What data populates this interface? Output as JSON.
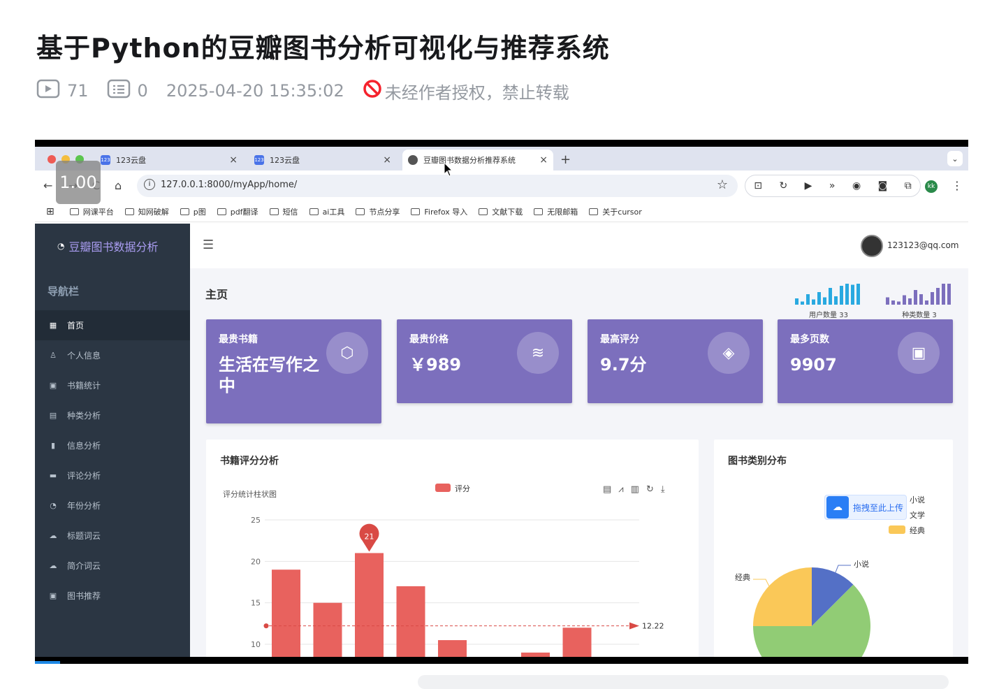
{
  "page": {
    "title": "基于Python的豆瓣图书分析可视化与推荐系统",
    "views": "71",
    "comments": "0",
    "date": "2025-04-20 15:35:02",
    "notice": "未经作者授权，禁止转载"
  },
  "player": {
    "speed": "1.00"
  },
  "browser": {
    "tabs": [
      {
        "label": "123云盘",
        "icon": "123"
      },
      {
        "label": "123云盘",
        "icon": "123"
      },
      {
        "label": "豆瓣图书数据分析推荐系统",
        "icon": "globe"
      }
    ],
    "url": "127.0.0.1:8000/myApp/home/",
    "profile": "kk",
    "bookmarks": [
      "网课平台",
      "知网破解",
      "p图",
      "pdf翻译",
      "短信",
      "ai工具",
      "节点分享",
      "Firefox 导入",
      "文献下载",
      "无限邮箱",
      "关于cursor"
    ]
  },
  "app": {
    "brand": "豆瓣图书数据分析",
    "nav_title": "导航栏",
    "menu": [
      {
        "label": "首页",
        "icon": "grid-icon",
        "glyph": "▦"
      },
      {
        "label": "个人信息",
        "icon": "person-icon",
        "glyph": "♙"
      },
      {
        "label": "书籍统计",
        "icon": "calendar-icon",
        "glyph": "▣"
      },
      {
        "label": "种类分析",
        "icon": "print-icon",
        "glyph": "▤"
      },
      {
        "label": "信息分析",
        "icon": "book-icon",
        "glyph": "▮"
      },
      {
        "label": "评论分析",
        "icon": "comment-icon",
        "glyph": "▬"
      },
      {
        "label": "年份分析",
        "icon": "history-icon",
        "glyph": "◔"
      },
      {
        "label": "标题词云",
        "icon": "cloud-icon",
        "glyph": "☁"
      },
      {
        "label": "简介词云",
        "icon": "cloud-upload-icon",
        "glyph": "☁"
      },
      {
        "label": "图书推荐",
        "icon": "plus-square-icon",
        "glyph": "▣"
      }
    ],
    "user_email": "123123@qq.com",
    "page_title": "主页",
    "mini_stats": [
      {
        "label": "用户数量 33",
        "color": "#29a9e0",
        "values": [
          0.3,
          0.15,
          0.5,
          0.25,
          0.6,
          0.35,
          0.8,
          0.4,
          0.9,
          1.0,
          0.95,
          1.0
        ]
      },
      {
        "label": "种类数量 3",
        "color": "#7c6fbd",
        "values": [
          0.35,
          0.2,
          0.15,
          0.45,
          0.3,
          0.7,
          0.5,
          0.2,
          0.6,
          0.8,
          1.0,
          1.0
        ]
      }
    ],
    "cards": [
      {
        "title": "最贵书籍",
        "value": "生活在写作之中",
        "icon": "box-icon",
        "glyph": "⬡"
      },
      {
        "title": "最贵价格",
        "value": "￥989",
        "icon": "layers-icon",
        "glyph": "≋"
      },
      {
        "title": "最高评分",
        "value": "9.7分",
        "icon": "tag-icon",
        "glyph": "◈"
      },
      {
        "title": "最多页数",
        "value": "9907",
        "icon": "briefcase-icon",
        "glyph": "▣"
      }
    ],
    "upload_overlay": "拖拽至此上传",
    "panels": {
      "rating": "书籍评分分析",
      "category": "图书类别分布"
    }
  },
  "chart_data": [
    {
      "type": "bar",
      "title": "评分统计柱状图",
      "series": [
        {
          "name": "评分",
          "values": [
            19,
            15,
            21,
            17,
            10.5,
            8,
            9,
            12
          ]
        }
      ],
      "color": "#e8625e",
      "ylim": [
        10,
        25
      ],
      "yticks": [
        10,
        15,
        20,
        25
      ],
      "max_label": "21",
      "average": 12.22,
      "grid": true
    },
    {
      "type": "pie",
      "slices": [
        {
          "name": "小说",
          "value": 12.5,
          "color": "#5470c6"
        },
        {
          "name": "文学",
          "value": 62.5,
          "color": "#91cc75"
        },
        {
          "name": "经典",
          "value": 25,
          "color": "#fac858"
        }
      ],
      "legend": "top-right"
    }
  ]
}
